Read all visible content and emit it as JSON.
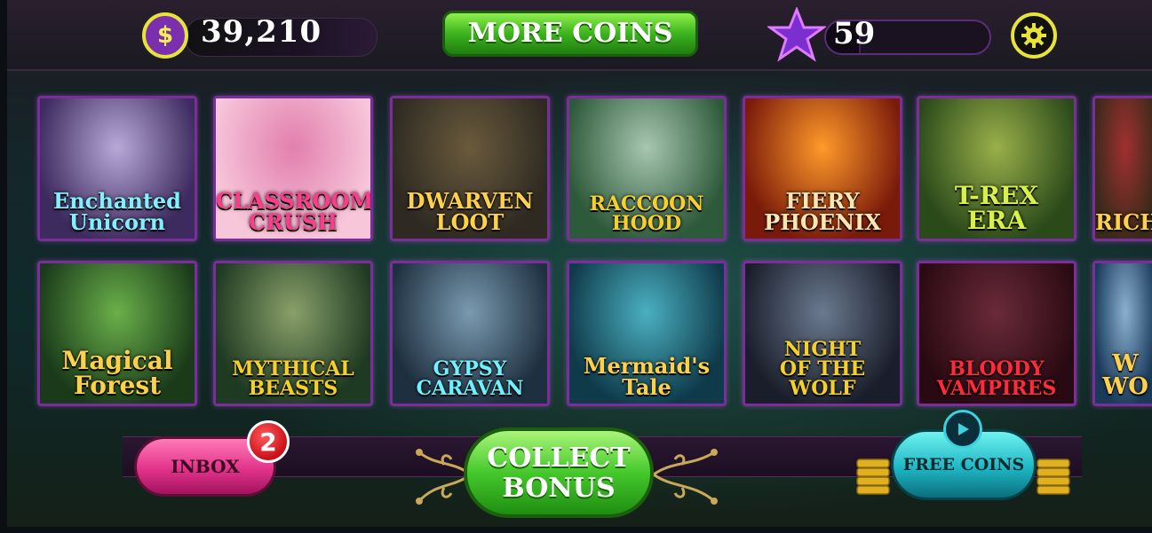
{
  "topbar": {
    "coin_symbol": "$",
    "coin_balance": "39,210",
    "more_coins_label": "MORE COINS",
    "level": "59",
    "level_progress": 0.2
  },
  "games": [
    {
      "id": "enchanted-unicorn",
      "label": "Enchanted\nUnicorn",
      "c1": "#3d2a5e",
      "c2": "#b8a8d8",
      "text": "#7ff0ff",
      "size": 24
    },
    {
      "id": "classroom-crush",
      "label": "CLASSROOM\nCRUSH",
      "c1": "#f7c6d9",
      "c2": "#e27fae",
      "text": "#ff3c8c",
      "size": 24
    },
    {
      "id": "dwarven-loot",
      "label": "DWARVEN\nLOOT",
      "c1": "#2e2a22",
      "c2": "#6a5a3c",
      "text": "#ffd04a",
      "size": 24
    },
    {
      "id": "raccoon-hood",
      "label": "RACCOON\nHOOD",
      "c1": "#2d5a3a",
      "c2": "#a8c6b0",
      "text": "#f6d02a",
      "size": 22
    },
    {
      "id": "fiery-phoenix",
      "label": "FIERY\nPHOENIX",
      "c1": "#7a1a0a",
      "c2": "#ff9a2a",
      "text": "#ffe6b0",
      "size": 24
    },
    {
      "id": "t-rex-era",
      "label": "T-REX\nERA",
      "c1": "#2a4a1a",
      "c2": "#9ab04a",
      "text": "#d8f04a",
      "size": 28
    },
    {
      "id": "riches",
      "label": "RICH",
      "c1": "#3a2a1a",
      "c2": "#a03030",
      "text": "#ffd04a",
      "size": 24
    },
    {
      "id": "magical-forest",
      "label": "Magical\nForest",
      "c1": "#1a3a1a",
      "c2": "#6ab04a",
      "text": "#ffd04a",
      "size": 28
    },
    {
      "id": "mythical-beasts",
      "label": "MYTHICAL\nBEASTS",
      "c1": "#1e3a22",
      "c2": "#8aa06a",
      "text": "#f6d02a",
      "size": 22
    },
    {
      "id": "gypsy-caravan",
      "label": "GYPSY\nCARAVAN",
      "c1": "#1e3040",
      "c2": "#7a9ab0",
      "text": "#6ff2ff",
      "size": 22
    },
    {
      "id": "mermaids-tale",
      "label": "Mermaid's\nTale",
      "c1": "#0f3a4a",
      "c2": "#4ab0c0",
      "text": "#ffd04a",
      "size": 24
    },
    {
      "id": "night-of-the-wolf",
      "label": "NIGHT\nOF THE\nWOLF",
      "c1": "#1a1e2a",
      "c2": "#6a7a90",
      "text": "#f6d02a",
      "size": 22
    },
    {
      "id": "bloody-vampires",
      "label": "BLOODY\nVAMPIRES",
      "c1": "#2a0a12",
      "c2": "#6a2a3a",
      "text": "#ff2a3a",
      "size": 22
    },
    {
      "id": "wild-wolf",
      "label": "W\nWO",
      "c1": "#1a3a5a",
      "c2": "#8ab0d0",
      "text": "#ffd04a",
      "size": 26
    }
  ],
  "bottom": {
    "inbox_label": "INBOX",
    "inbox_count": "2",
    "collect_label": "COLLECT\nBONUS",
    "free_coins_label": "FREE COINS"
  },
  "colors": {
    "tile_border": "#7a2e9a",
    "accent_yellow": "#e8e33a",
    "green_button": "#3cb31e"
  },
  "icons": [
    "coin-icon",
    "star-icon",
    "gear-icon",
    "play-icon"
  ]
}
